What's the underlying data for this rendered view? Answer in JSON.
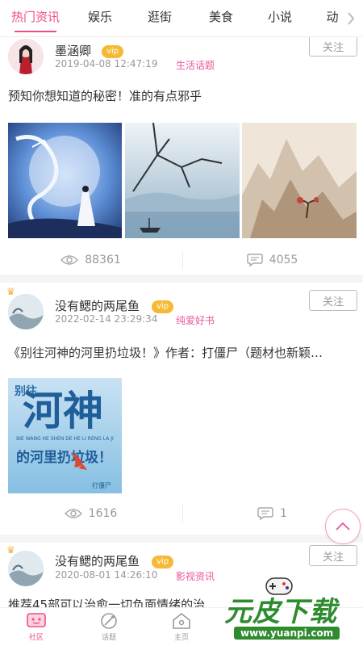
{
  "tabs": [
    "热门资讯",
    "娱乐",
    "逛街",
    "美食",
    "小说",
    "动"
  ],
  "active_tab": 0,
  "posts": [
    {
      "user": "墨涵卿",
      "vip": "vip",
      "time": "2019-04-08 12:47:19",
      "tag": "生活话题",
      "follow": "关注",
      "title": "预知你想知道的秘密！准的有点邪乎",
      "views": "88361",
      "comments": "4055"
    },
    {
      "user": "没有鳃的两尾鱼",
      "vip": "vip",
      "time": "2022-02-14 23:29:34",
      "tag": "纯爱好书",
      "follow": "关注",
      "title": "《别往河神的河里扔垃圾！》作者：打僵尸（题材也新颖…",
      "cover_small": "别往",
      "cover_big": "河神",
      "cover_sub": "的河里扔垃圾！",
      "cover_pinyin": "BIE WANG HE SHEN DE HE LI RENG LA JI",
      "cover_author": "打僵尸",
      "views": "1616",
      "comments": "1"
    },
    {
      "user": "没有鳃的两尾鱼",
      "vip": "vip",
      "time": "2020-08-01 14:26:10",
      "tag": "影视资讯",
      "follow": "关注",
      "title": "推荐45部可以治愈一切负面情绪的治"
    }
  ],
  "nav": [
    {
      "label": "社区",
      "icon": "community-icon"
    },
    {
      "label": "话题",
      "icon": "topic-icon"
    },
    {
      "label": "主页",
      "icon": "home-icon"
    }
  ],
  "watermark": {
    "main": "元皮下载",
    "url": "www.yuanpi.com"
  },
  "colors": {
    "accent": "#f04c86",
    "vip": "#f6b936",
    "tag": "#e9559a"
  }
}
